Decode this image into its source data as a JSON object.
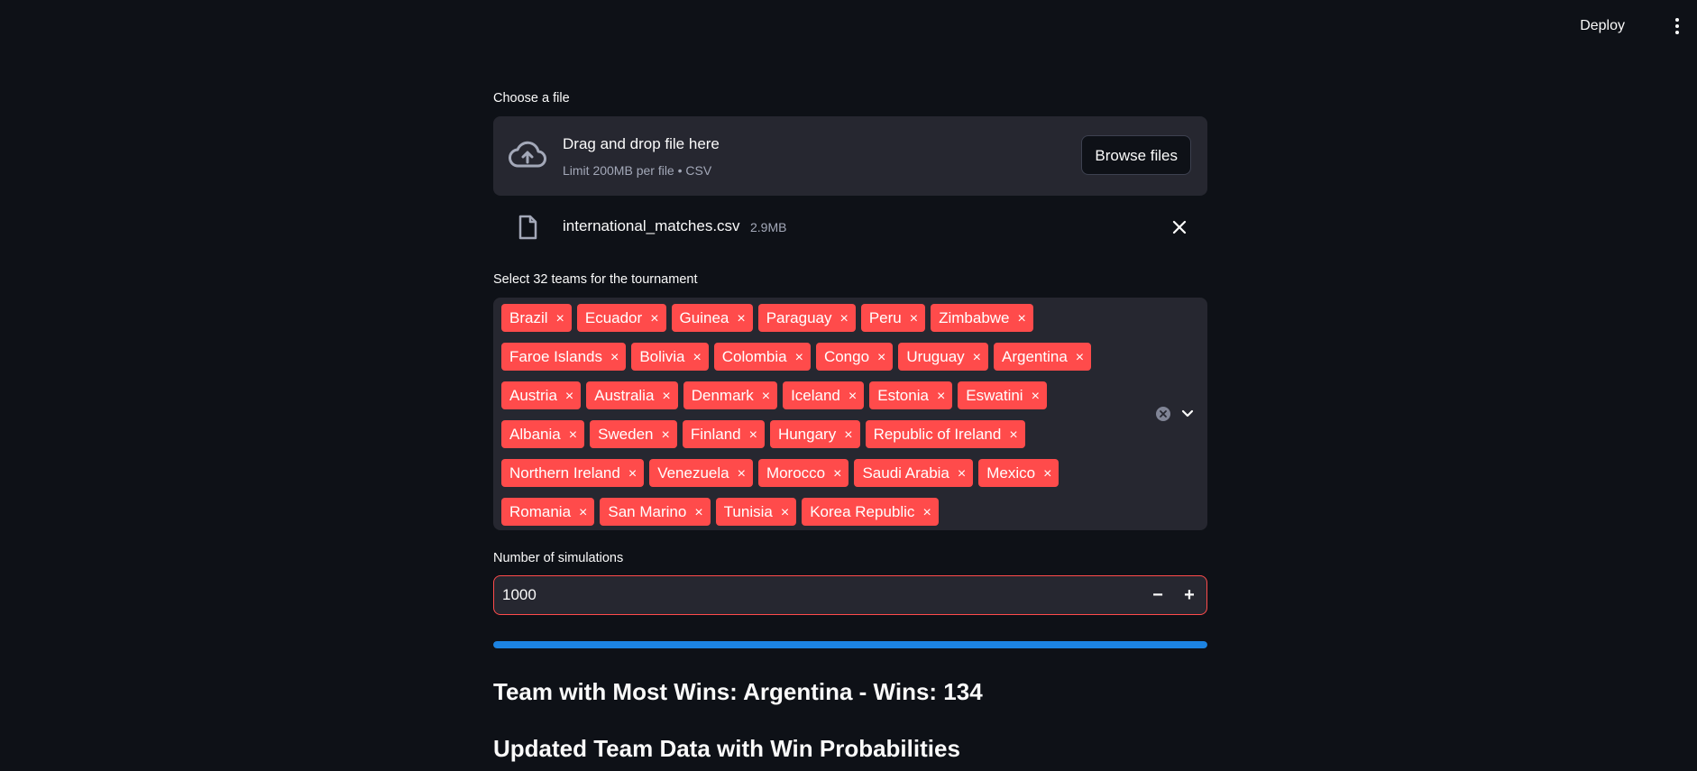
{
  "header": {
    "deploy_label": "Deploy"
  },
  "uploader": {
    "label": "Choose a file",
    "title": "Drag and drop file here",
    "subtitle": "Limit 200MB per file • CSV",
    "browse_label": "Browse files",
    "file": {
      "name": "international_matches.csv",
      "size": "2.9MB"
    }
  },
  "teams": {
    "label": "Select 32 teams for the tournament",
    "rows": [
      [
        "Brazil",
        "Ecuador",
        "Guinea",
        "Paraguay",
        "Peru",
        "Zimbabwe"
      ],
      [
        "Faroe Islands",
        "Bolivia",
        "Colombia",
        "Congo",
        "Uruguay",
        "Argentina"
      ],
      [
        "Austria",
        "Australia",
        "Denmark",
        "Iceland",
        "Estonia",
        "Eswatini"
      ],
      [
        "Albania",
        "Sweden",
        "Finland",
        "Hungary",
        "Republic of Ireland"
      ],
      [
        "Northern Ireland",
        "Venezuela",
        "Morocco",
        "Saudi Arabia",
        "Mexico"
      ],
      [
        "Romania",
        "San Marino",
        "Tunisia",
        "Korea Republic"
      ]
    ],
    "chip_remove_glyph": "×",
    "chip_color": "#ff4b4b"
  },
  "simulations": {
    "label": "Number of simulations",
    "value": "1000",
    "minus": "−",
    "plus": "+"
  },
  "progress": {
    "fraction": 1.0,
    "color": "#1c83e1"
  },
  "results": {
    "most_wins": "Team with Most Wins: Argentina - Wins: 134",
    "table_heading": "Updated Team Data with Win Probabilities"
  }
}
